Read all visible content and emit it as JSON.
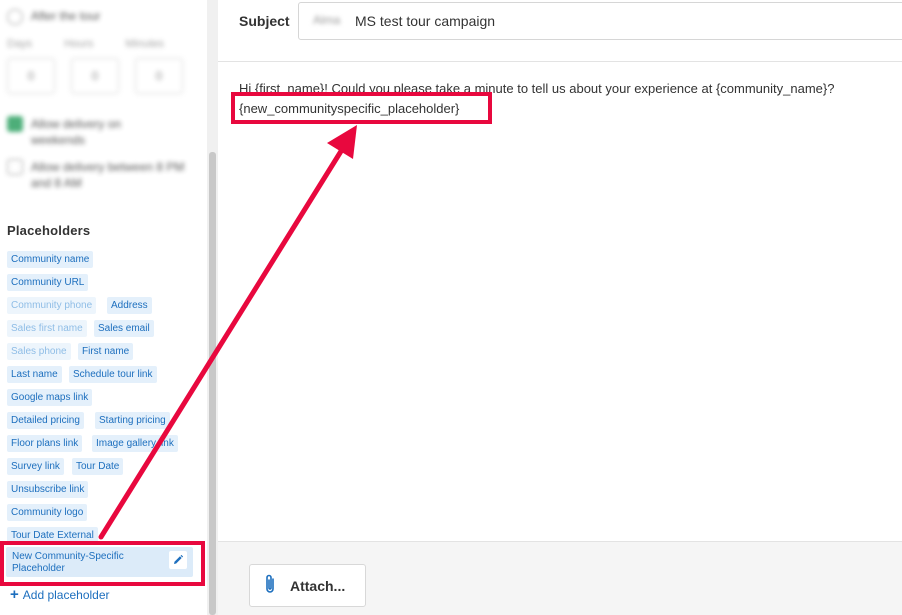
{
  "sidebar": {
    "after_tour_label": "After the tour",
    "units": [
      "Days",
      "Hours",
      "Minutes"
    ],
    "unit_values": [
      "0",
      "0",
      "0"
    ],
    "weekends_label": "Allow delivery on weekends",
    "night_label": "Allow delivery between 8 PM and 8 AM",
    "placeholders_title": "Placeholders",
    "chips": [
      {
        "label": "Community name",
        "enabled": true
      },
      {
        "label": "Community URL",
        "enabled": true
      },
      {
        "label": "Community phone",
        "enabled": false
      },
      {
        "label": "Address",
        "enabled": true
      },
      {
        "label": "Sales first name",
        "enabled": false
      },
      {
        "label": "Sales email",
        "enabled": true
      },
      {
        "label": "Sales phone",
        "enabled": false
      },
      {
        "label": "First name",
        "enabled": true
      },
      {
        "label": "Last name",
        "enabled": true
      },
      {
        "label": "Schedule tour link",
        "enabled": true
      },
      {
        "label": "Google maps link",
        "enabled": true
      },
      {
        "label": "Detailed pricing",
        "enabled": true
      },
      {
        "label": "Starting pricing",
        "enabled": true
      },
      {
        "label": "Floor plans link",
        "enabled": true
      },
      {
        "label": "Image gallery link",
        "enabled": true
      },
      {
        "label": "Survey link",
        "enabled": true
      },
      {
        "label": "Tour Date",
        "enabled": true
      },
      {
        "label": "Unsubscribe link",
        "enabled": true
      },
      {
        "label": "Community logo",
        "enabled": true
      },
      {
        "label": "Tour Date External",
        "enabled": true
      }
    ],
    "new_placeholder_label": "New Community-Specific Placeholder",
    "add_placeholder_label": "Add placeholder"
  },
  "editor": {
    "subject_label": "Subject",
    "subject_redacted": "Alma",
    "subject_value": "MS test tour campaign",
    "body_line1": "Hi {first_name}!  Could you please take a minute to tell us about your experience at {community_name}?",
    "body_line2": "{new_communityspecific_placeholder}",
    "attach_label": "Attach..."
  },
  "colors": {
    "annotation": "#e8083e",
    "chip_bg": "#e4f0fb",
    "chip_text": "#1d6fbe",
    "checkbox_on": "#3aa66b"
  },
  "icons": [
    "pencil-icon",
    "paperclip-icon",
    "plus-icon"
  ]
}
